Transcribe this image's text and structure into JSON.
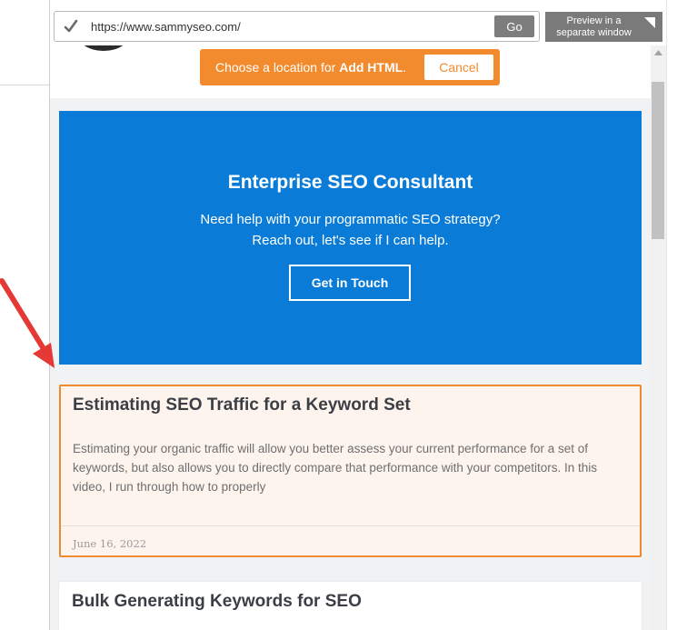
{
  "toolbar": {
    "url": "https://www.sammyseo.com/",
    "go_label": "Go",
    "preview_label": "Preview in a separate window"
  },
  "add_html_bar": {
    "prefix": "Choose a location for ",
    "bold": "Add HTML",
    "suffix": ".",
    "cancel_label": "Cancel",
    "color": "#f28a2e"
  },
  "cta": {
    "title": "Enterprise SEO Consultant",
    "line1": "Need help with your programmatic SEO strategy?",
    "line2": "Reach out, let's see if I can help.",
    "button_label": "Get in Touch",
    "color": "#0a7cd8"
  },
  "posts": [
    {
      "title": "Estimating SEO Traffic for a Keyword Set",
      "excerpt": "Estimating your organic traffic will allow you better assess your current performance for a set of keywords, but also allows you to directly compare that performance with your competitors. In this video, I run through how to properly",
      "date": "June 16, 2022",
      "highlight_color": "#ef8a2f"
    },
    {
      "title": "Bulk Generating Keywords for SEO"
    }
  ],
  "icons": {
    "url_status": "check-icon",
    "preview": "new-window-corner-icon",
    "scroll": "scroll-up-arrow-icon",
    "annotation": "red-arrow-icon"
  }
}
